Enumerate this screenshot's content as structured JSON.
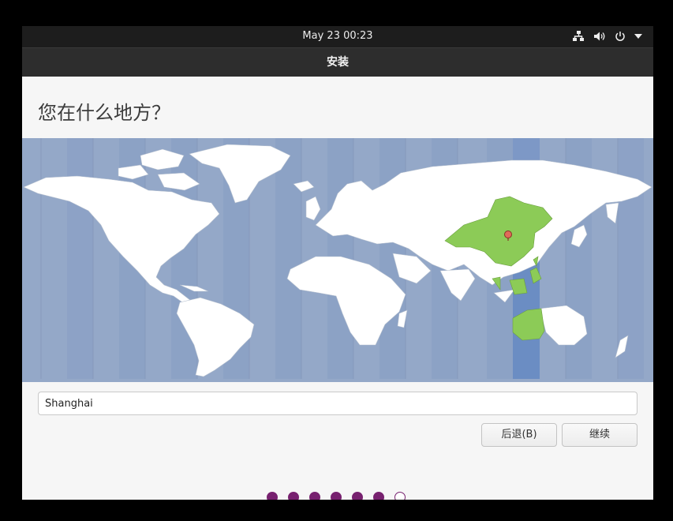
{
  "topbar": {
    "clock": "May 23  00:23",
    "icons": [
      "network-icon",
      "volume-icon",
      "power-icon",
      "menu-arrow-icon"
    ]
  },
  "window": {
    "title": "安装"
  },
  "page": {
    "heading": "您在什么地方？"
  },
  "map": {
    "selected_city": "Shanghai",
    "highlight_color": "#8ccb57",
    "timezone_band_color": "#6b8dc3",
    "ocean_color": "#94a8c8",
    "land_color": "#ffffff",
    "pin_color": "#e06b5a"
  },
  "timezone_field": {
    "value": "Shanghai"
  },
  "buttons": {
    "back": "后退(B)",
    "next": "继续"
  },
  "progress": {
    "total_steps": 7,
    "current_step": 7,
    "dot_color": "#77216f"
  }
}
